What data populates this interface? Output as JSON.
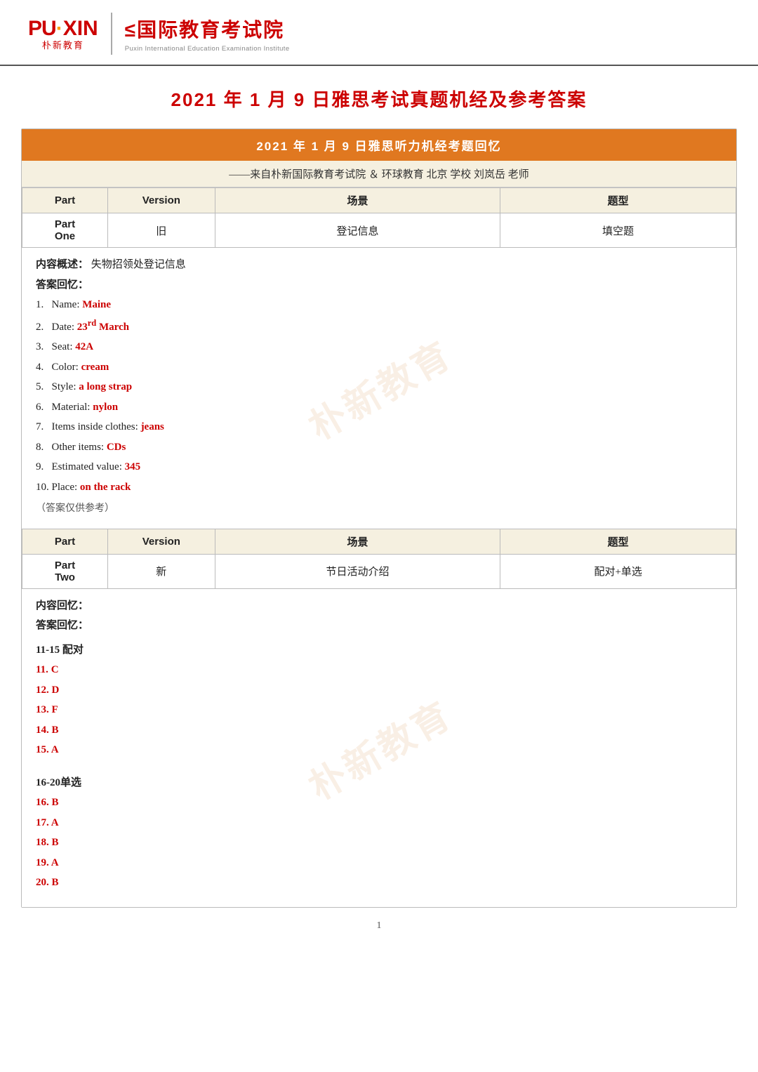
{
  "header": {
    "logo_puxin_text": "PU·XIN",
    "logo_puxin_sub": "朴新教育",
    "logo_institute_chinese": "≤国际教育考试院",
    "logo_institute_english": "Puxin International Education Examination Institute",
    "divider": true
  },
  "main_title": "2021 年  1 月  9 日雅思考试真题机经及参考答案",
  "card": {
    "header_text": "2021 年  1 月  9 日雅思听力机经考题回忆",
    "subtitle": "——来自朴新国际教育考试院 ＆ 环球教育   北京 学校   刘岚岳   老师",
    "table_headers": [
      "Part",
      "Version",
      "场景",
      "题型"
    ],
    "part_one": {
      "part_label": "Part",
      "part_name": "One",
      "version": "旧",
      "scene": "登记信息",
      "question_type": "填空题",
      "content_desc_label": "内容概述：",
      "content_desc": "失物招领处登记信息",
      "answer_recall_label": "答案回忆：",
      "answers": [
        {
          "num": "1.",
          "prefix": "Name: ",
          "answer": "Maine"
        },
        {
          "num": "2.",
          "prefix": "Date: ",
          "answer": "23rd March"
        },
        {
          "num": "3.",
          "prefix": "Seat: ",
          "answer": "42A"
        },
        {
          "num": "4.",
          "prefix": "Color: ",
          "answer": "cream"
        },
        {
          "num": "5.",
          "prefix": "Style: ",
          "answer": "a long strap"
        },
        {
          "num": "6.",
          "prefix": "Material: ",
          "answer": "nylon"
        },
        {
          "num": "7.",
          "prefix": "Items inside clothes: ",
          "answer": "jeans"
        },
        {
          "num": "8.",
          "prefix": "Other items: ",
          "answer": "CDs"
        },
        {
          "num": "9.",
          "prefix": "Estimated value: ",
          "answer": "345"
        },
        {
          "num": "10.",
          "prefix": "Place: ",
          "answer": "on the rack"
        }
      ],
      "note": "（答案仅供参考）"
    },
    "part_two": {
      "part_label": "Part",
      "part_name": "Two",
      "version": "新",
      "scene": "节日活动介绍",
      "question_type": "配对+单选",
      "content_recall_label": "内容回忆：",
      "answer_recall_label": "答案回忆：",
      "group1_title": "11-15  配对",
      "group1_answers": [
        {
          "num": "11.",
          "answer": "C"
        },
        {
          "num": "12.",
          "answer": "D"
        },
        {
          "num": "13.",
          "answer": "F"
        },
        {
          "num": "14.",
          "answer": "B"
        },
        {
          "num": "15.",
          "answer": "A"
        }
      ],
      "group2_title": "16-20单选",
      "group2_answers": [
        {
          "num": "16.",
          "answer": "B"
        },
        {
          "num": "17.",
          "answer": "A"
        },
        {
          "num": "18.",
          "answer": "B"
        },
        {
          "num": "19.",
          "answer": "A"
        },
        {
          "num": "20.",
          "answer": "B"
        }
      ]
    }
  },
  "watermark_text": "朴新教育",
  "page_number": "1"
}
